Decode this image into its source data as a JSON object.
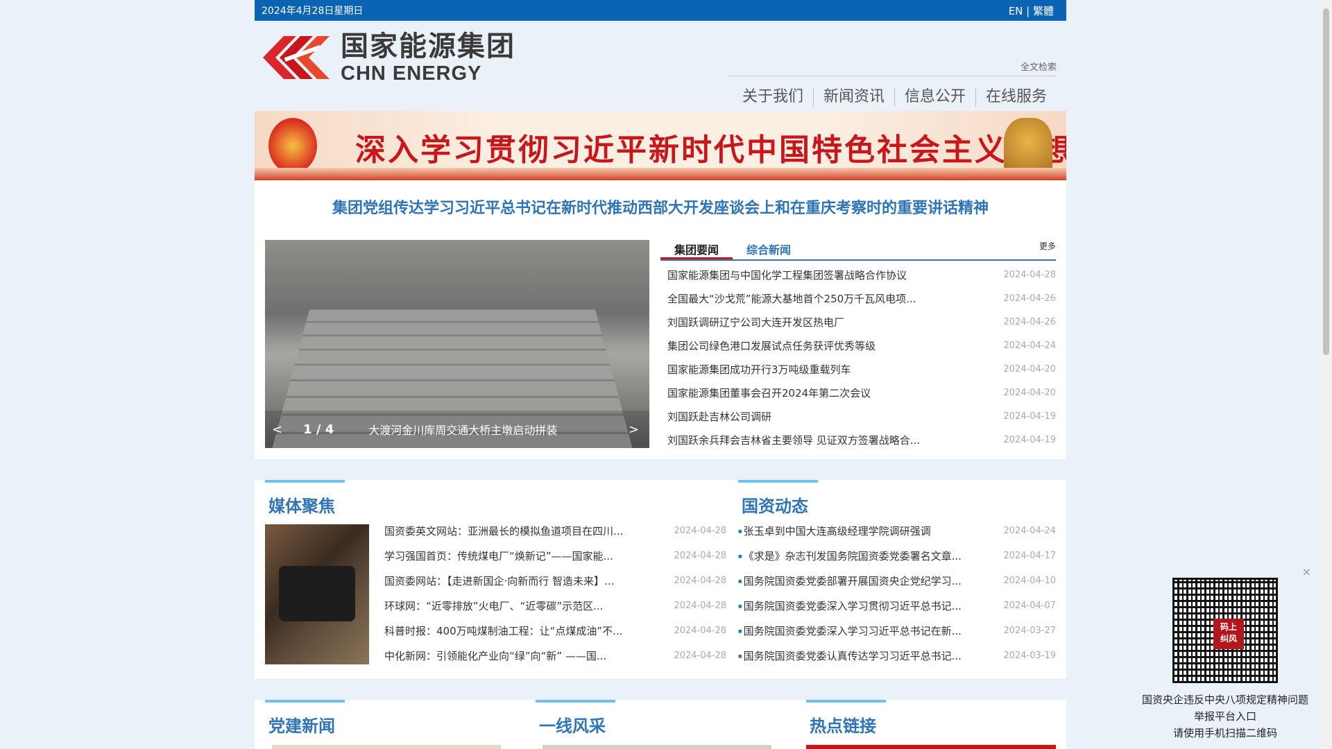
{
  "topbar": {
    "date": "2024年4月28日星期日",
    "lang_en": "EN",
    "lang_sep": " | ",
    "lang_tw": "繁體"
  },
  "header": {
    "logo_cn": "国家能源集团",
    "logo_en": "CHN ENERGY",
    "fulltext_search": "全文检索",
    "nav": [
      "关于我们",
      "新闻资讯",
      "信息公开",
      "在线服务"
    ]
  },
  "banner": {
    "slogan": "深入学习贯彻习近平新时代中国特色社会主义思想"
  },
  "headline": "集团党组传达学习习近平总书记在新时代推动西部大开发座谈会上和在重庆考察时的重要讲话精神",
  "slider": {
    "prev": "<",
    "next": ">",
    "counter": "1 / 4",
    "caption": "大渡河金川库周交通大桥主墩启动拼装"
  },
  "news": {
    "tabs": [
      "集团要闻",
      "综合新闻"
    ],
    "more": "更多",
    "items": [
      {
        "title": "国家能源集团与中国化学工程集团签署战略合作协议",
        "date": "2024-04-28"
      },
      {
        "title": "全国最大“沙戈荒”能源大基地首个250万千瓦风电项...",
        "date": "2024-04-26"
      },
      {
        "title": "刘国跃调研辽宁公司大连开发区热电厂",
        "date": "2024-04-26"
      },
      {
        "title": "集团公司绿色港口发展试点任务获评优秀等级",
        "date": "2024-04-24"
      },
      {
        "title": "国家能源集团成功开行3万吨级重载列车",
        "date": "2024-04-20"
      },
      {
        "title": "国家能源集团董事会召开2024年第二次会议",
        "date": "2024-04-20"
      },
      {
        "title": "刘国跃赴吉林公司调研",
        "date": "2024-04-19"
      },
      {
        "title": "刘国跃余兵拜会吉林省主要领导 见证双方签署战略合...",
        "date": "2024-04-19"
      }
    ]
  },
  "media": {
    "title": "媒体聚焦",
    "items": [
      {
        "title": "国资委英文网站：亚洲最长的模拟鱼道项目在四川...",
        "date": "2024-04-28"
      },
      {
        "title": "学习强国首页：传统煤电厂“焕新记”——国家能...",
        "date": "2024-04-28"
      },
      {
        "title": "国资委网站：【走进新国企·向新而行 智造未来】...",
        "date": "2024-04-28"
      },
      {
        "title": "环球网：“近零排放”火电厂、“近零碳”示范区...",
        "date": "2024-04-28"
      },
      {
        "title": "科普时报：400万吨煤制油工程：让“点煤成油”不...",
        "date": "2024-04-28"
      },
      {
        "title": "中化新网：引领能化产业向“绿”向“新” ——国...",
        "date": "2024-04-28"
      }
    ]
  },
  "state": {
    "title": "国资动态",
    "items": [
      {
        "title": "张玉卓到中国大连高级经理学院调研强调",
        "date": "2024-04-24"
      },
      {
        "title": "《求是》杂志刊发国务院国资委党委署名文章...",
        "date": "2024-04-17"
      },
      {
        "title": "国务院国资委党委部署开展国资央企党纪学习...",
        "date": "2024-04-10"
      },
      {
        "title": "国务院国资委党委深入学习贯彻习近平总书记...",
        "date": "2024-04-07"
      },
      {
        "title": "国务院国资委党委深入学习习近平总书记在新...",
        "date": "2024-03-27"
      },
      {
        "title": "国务院国资委党委认真传达学习习近平总书记...",
        "date": "2024-03-19"
      }
    ]
  },
  "bottom": {
    "party": "党建新闻",
    "frontline": "一线风采",
    "hotlinks": "热点链接"
  },
  "qr": {
    "close": "×",
    "badge_line1": "码上",
    "badge_line2": "纠风",
    "caption1": "国资央企违反中央八项规定精神问题",
    "caption2": "举报平台入口",
    "caption3": "请使用手机扫描二维码"
  }
}
